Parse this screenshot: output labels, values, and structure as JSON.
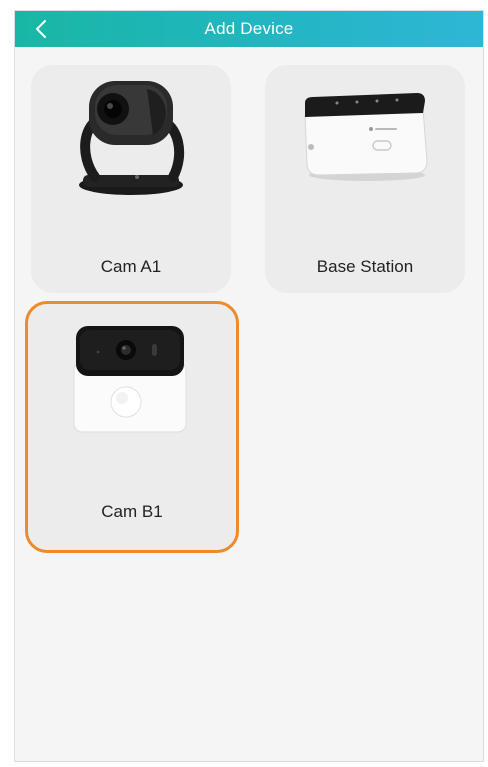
{
  "header": {
    "title": "Add Device",
    "back_icon": "chevron-left-icon"
  },
  "colors": {
    "header_start": "#18b7a4",
    "header_end": "#2fb6d6",
    "selected_border": "#ec8a2c",
    "card_bg": "#ececec"
  },
  "devices": [
    {
      "label": "Cam A1",
      "selected": false
    },
    {
      "label": "Base Station",
      "selected": false
    },
    {
      "label": "Cam B1",
      "selected": true
    }
  ]
}
